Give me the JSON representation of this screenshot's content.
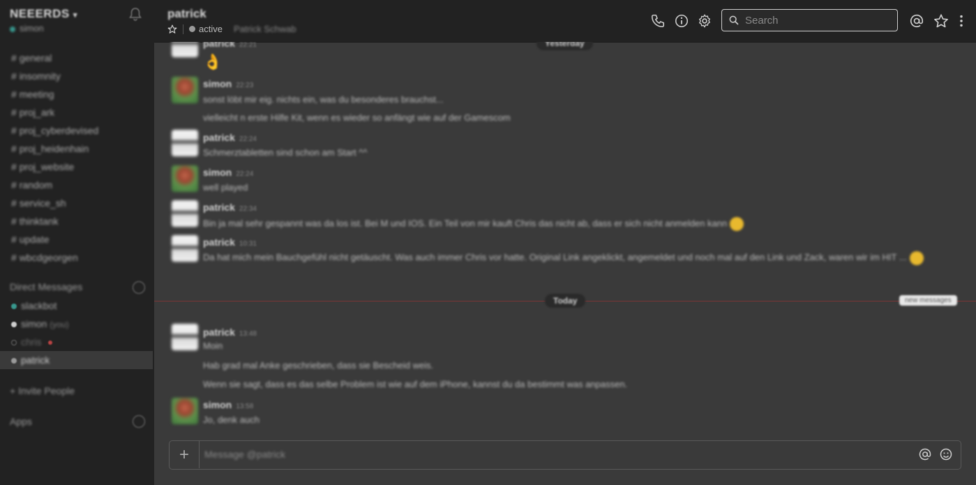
{
  "workspace": {
    "name": "NEEERDS",
    "current_user": "simon"
  },
  "channels": [
    "general",
    "insomnity",
    "meeting",
    "proj_ark",
    "proj_cyberdevised",
    "proj_heidenhain",
    "proj_website",
    "random",
    "service_sh",
    "thinktank",
    "update",
    "wbcdgeorgen"
  ],
  "direct_messages": {
    "label": "Direct Messages",
    "items": [
      {
        "name": "slackbot",
        "note": "",
        "status_color": "#38978d"
      },
      {
        "name": "simon",
        "note": "(you)",
        "status_color": "#cfcfcf"
      },
      {
        "name": "chris",
        "note": "",
        "status_color": "#6a6a6a"
      },
      {
        "name": "patrick",
        "note": "",
        "status_color": "#9a9a9a"
      }
    ]
  },
  "invite_label": "+ Invite People",
  "apps_label": "Apps",
  "header": {
    "title": "patrick",
    "status": "active",
    "full_name": "Patrick Schwab"
  },
  "search": {
    "placeholder": "Search"
  },
  "day_labels": {
    "earlier": "Yesterday",
    "today": "Today"
  },
  "new_messages_label": "new messages",
  "messages": [
    {
      "user": "patrick",
      "time": "22:21",
      "lines": [
        "👌"
      ]
    },
    {
      "user": "simon",
      "time": "22:23",
      "lines": [
        "sonst löbt mir eig. nichts ein, was du besonderes brauchst...",
        "vielleicht n erste Hilfe Kit, wenn es wieder so anfängt wie auf der Gamescom"
      ]
    },
    {
      "user": "patrick",
      "time": "22:24",
      "lines": [
        "Schmerztabletten sind schon am Start ^^"
      ]
    },
    {
      "user": "simon",
      "time": "22:24",
      "lines": [
        "well played"
      ]
    },
    {
      "user": "patrick",
      "time": "22:34",
      "lines": [
        "Bin ja mal sehr gespannt was da los ist. Bei M und IOS. Ein Teil von mir kauft Chris das nicht ab, dass er sich nicht anmelden kann"
      ]
    },
    {
      "user": "patrick",
      "time": "10:31",
      "lines": [
        "Da hat mich mein Bauchgefühl nicht getäuscht. Was auch immer Chris vor hatte. Original Link angeklickt, angemeldet und noch mal auf den Link und Zack, waren wir im HIT ..."
      ]
    },
    {
      "user": "patrick",
      "time": "13:48",
      "lines": [
        "Moin",
        "Hab grad mal Anke geschrieben, dass sie Bescheid weis.",
        "Wenn sie sagt, dass es das selbe Problem ist wie auf dem iPhone, kannst du da bestimmt was anpassen."
      ]
    },
    {
      "user": "simon",
      "time": "13:58",
      "lines": [
        "Jo, denk auch"
      ]
    }
  ],
  "composer": {
    "placeholder": "Message @patrick"
  }
}
